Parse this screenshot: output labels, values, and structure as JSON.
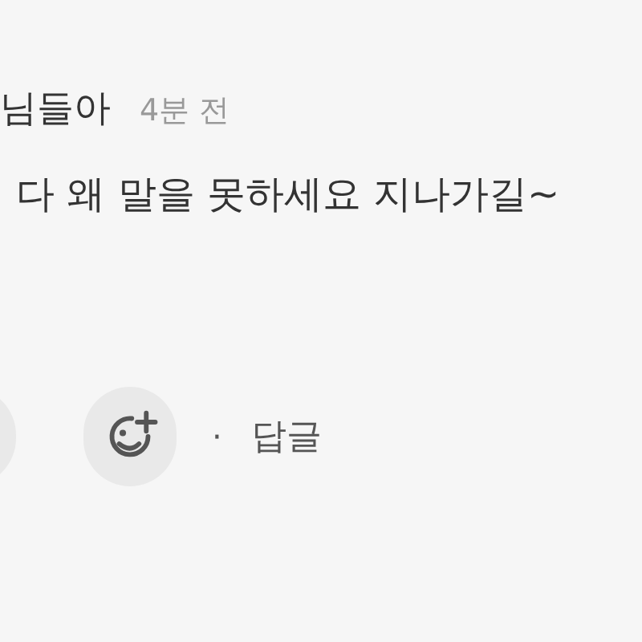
{
  "comment": {
    "author": "님들아",
    "time": "4분 전",
    "text": "다 왜 말을 못하세요 지나가길~"
  },
  "actions": [
    {
      "kind": "reaction"
    },
    {
      "kind": "add-emoji"
    },
    {
      "kind": "separator",
      "label": "·"
    },
    {
      "kind": "reply",
      "label": "답글"
    }
  ]
}
